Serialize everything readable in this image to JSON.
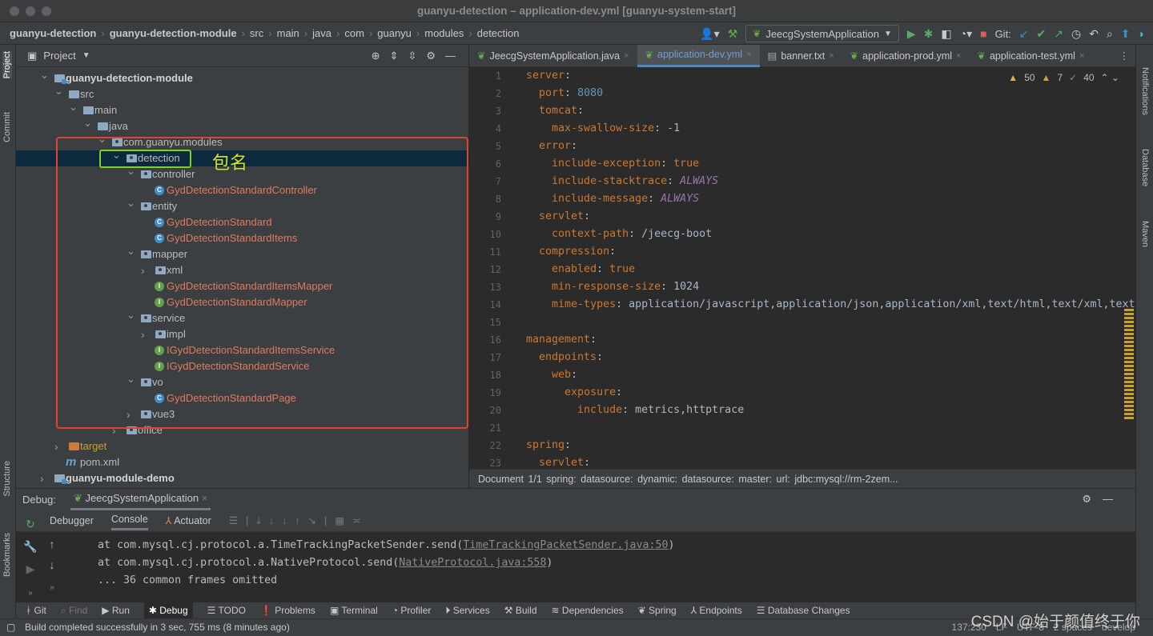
{
  "window": {
    "title": "guanyu-detection – application-dev.yml [guanyu-system-start]"
  },
  "breadcrumb": [
    "guanyu-detection",
    "guanyu-detection-module",
    "src",
    "main",
    "java",
    "com",
    "guanyu",
    "modules",
    "detection"
  ],
  "toolbar": {
    "run_config": "JeecgSystemApplication",
    "git_label": "Git:"
  },
  "project": {
    "title": "Project",
    "tree": [
      {
        "level": 0,
        "label": "guanyu-detection-module",
        "type": "module",
        "open": true,
        "bold": true
      },
      {
        "level": 1,
        "label": "src",
        "type": "folder",
        "open": true
      },
      {
        "level": 2,
        "label": "main",
        "type": "folder",
        "open": true
      },
      {
        "level": 3,
        "label": "java",
        "type": "folder",
        "open": true
      },
      {
        "level": 4,
        "label": "com.guanyu.modules",
        "type": "package",
        "open": true
      },
      {
        "level": 5,
        "label": "detection",
        "type": "package",
        "open": true,
        "selected": true
      },
      {
        "level": 6,
        "label": "controller",
        "type": "package",
        "open": true
      },
      {
        "level": 7,
        "label": "GydDetectionStandardController",
        "type": "class"
      },
      {
        "level": 6,
        "label": "entity",
        "type": "package",
        "open": true
      },
      {
        "level": 7,
        "label": "GydDetectionStandard",
        "type": "class"
      },
      {
        "level": 7,
        "label": "GydDetectionStandardItems",
        "type": "class"
      },
      {
        "level": 6,
        "label": "mapper",
        "type": "package",
        "open": true
      },
      {
        "level": 7,
        "label": "xml",
        "type": "package",
        "open": false
      },
      {
        "level": 7,
        "label": "GydDetectionStandardItemsMapper",
        "type": "interface"
      },
      {
        "level": 7,
        "label": "GydDetectionStandardMapper",
        "type": "interface"
      },
      {
        "level": 6,
        "label": "service",
        "type": "package",
        "open": true
      },
      {
        "level": 7,
        "label": "impl",
        "type": "package",
        "open": false
      },
      {
        "level": 7,
        "label": "IGydDetectionStandardItemsService",
        "type": "interface"
      },
      {
        "level": 7,
        "label": "IGydDetectionStandardService",
        "type": "interface"
      },
      {
        "level": 6,
        "label": "vo",
        "type": "package",
        "open": true
      },
      {
        "level": 7,
        "label": "GydDetectionStandardPage",
        "type": "class"
      },
      {
        "level": 6,
        "label": "vue3",
        "type": "package",
        "open": false
      },
      {
        "level": 5,
        "label": "office",
        "type": "package",
        "open": false
      },
      {
        "level": 1,
        "label": "target",
        "type": "target",
        "open": false
      },
      {
        "level": 1,
        "label": "pom.xml",
        "type": "maven"
      },
      {
        "level": 0,
        "label": "guanyu-module-demo",
        "type": "module",
        "open": false,
        "bold": true
      }
    ]
  },
  "annotation": {
    "label": "包名"
  },
  "editor": {
    "tabs": [
      {
        "label": "JeecgSystemApplication.java",
        "active": false
      },
      {
        "label": "application-dev.yml",
        "active": true
      },
      {
        "label": "banner.txt",
        "active": false
      },
      {
        "label": "application-prod.yml",
        "active": false
      },
      {
        "label": "application-test.yml",
        "active": false
      }
    ],
    "inspections": {
      "warnings": "50",
      "weak": "7",
      "ok": "40"
    },
    "lines": [
      {
        "i": 0,
        "k": "server",
        "v": "",
        "t": ""
      },
      {
        "i": 1,
        "k": "port",
        "v": "8080",
        "t": "num"
      },
      {
        "i": 1,
        "k": "tomcat",
        "v": "",
        "t": ""
      },
      {
        "i": 2,
        "k": "max-swallow-size",
        "v": "-1",
        "t": "v"
      },
      {
        "i": 1,
        "k": "error",
        "v": "",
        "t": ""
      },
      {
        "i": 2,
        "k": "include-exception",
        "v": "true",
        "t": "k"
      },
      {
        "i": 2,
        "k": "include-stacktrace",
        "v": "ALWAYS",
        "t": "it"
      },
      {
        "i": 2,
        "k": "include-message",
        "v": "ALWAYS",
        "t": "it"
      },
      {
        "i": 1,
        "k": "servlet",
        "v": "",
        "t": ""
      },
      {
        "i": 2,
        "k": "context-path",
        "v": "/jeecg-boot",
        "t": "v"
      },
      {
        "i": 1,
        "k": "compression",
        "v": "",
        "t": ""
      },
      {
        "i": 2,
        "k": "enabled",
        "v": "true",
        "t": "k"
      },
      {
        "i": 2,
        "k": "min-response-size",
        "v": "1024",
        "t": "v"
      },
      {
        "i": 2,
        "k": "mime-types",
        "v": "application/javascript,application/json,application/xml,text/html,text/xml,text",
        "t": "v"
      },
      {
        "i": 0,
        "k": "",
        "v": "",
        "t": ""
      },
      {
        "i": 0,
        "k": "management",
        "v": "",
        "t": ""
      },
      {
        "i": 1,
        "k": "endpoints",
        "v": "",
        "t": ""
      },
      {
        "i": 2,
        "k": "web",
        "v": "",
        "t": ""
      },
      {
        "i": 3,
        "k": "exposure",
        "v": "",
        "t": ""
      },
      {
        "i": 4,
        "k": "include",
        "v": "metrics,httptrace",
        "t": "v"
      },
      {
        "i": 0,
        "k": "",
        "v": "",
        "t": ""
      },
      {
        "i": 0,
        "k": "spring",
        "v": "",
        "t": ""
      },
      {
        "i": 1,
        "k": "servlet",
        "v": "",
        "t": ""
      }
    ],
    "path": "Document 1/1   spring:   datasource:   dynamic:   datasource:   master:   url:   jdbc:mysql://rm-2zem..."
  },
  "debug": {
    "label": "Debug:",
    "session": "JeecgSystemApplication",
    "tabs": [
      "Debugger",
      "Console",
      "Actuator"
    ],
    "console": [
      {
        "pre": "at com.mysql.cj.protocol.a.TimeTrackingPacketSender.send(",
        "link": "TimeTrackingPacketSender.java:50",
        "post": ")"
      },
      {
        "pre": "at com.mysql.cj.protocol.a.NativeProtocol.send(",
        "link": "NativeProtocol.java:558",
        "post": ")"
      },
      {
        "pre": "... 36 common frames omitted",
        "link": "",
        "post": ""
      }
    ]
  },
  "toolwindows": [
    "Git",
    "Find",
    "Run",
    "Debug",
    "TODO",
    "Problems",
    "Terminal",
    "Profiler",
    "Services",
    "Build",
    "Dependencies",
    "Spring",
    "Endpoints",
    "Database Changes"
  ],
  "left_strip": [
    "Project",
    "Commit",
    "Structure",
    "Bookmarks"
  ],
  "right_strip": [
    "Notifications",
    "Database",
    "Maven"
  ],
  "status": {
    "message": "Build completed successfully in 3 sec, 755 ms (8 minutes ago)",
    "position": "137:230",
    "line_sep": "LF",
    "encoding": "UTF-8",
    "indent": "2 spaces",
    "branch": "develop"
  },
  "watermark": "CSDN @始于颜值终于你"
}
